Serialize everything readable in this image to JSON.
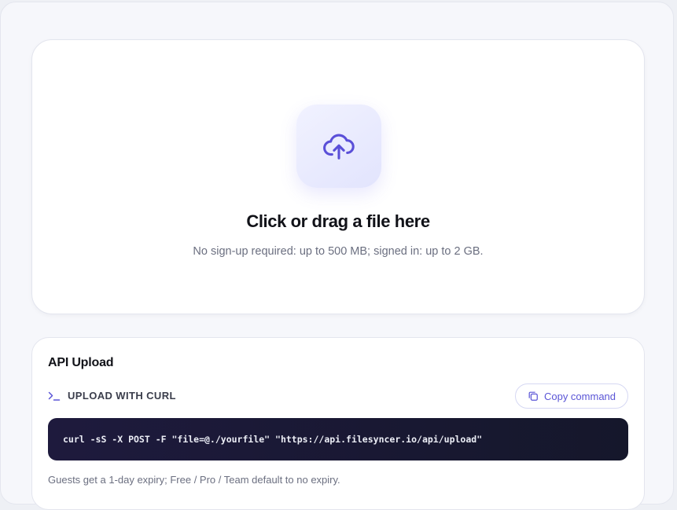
{
  "dropzone": {
    "icon": "cloud-upload-icon",
    "title": "Click or drag a file here",
    "subtitle": "No sign-up required: up to 500 MB; signed in: up to 2 GB."
  },
  "api": {
    "title": "API Upload",
    "section_icon": "terminal-icon",
    "section_label": "UPLOAD WITH CURL",
    "copy_icon": "copy-icon",
    "copy_label": "Copy command",
    "command": "curl -sS -X POST -F \"file=@./yourfile\" \"https://api.filesyncer.io/api/upload\"",
    "note": "Guests get a 1-day expiry; Free / Pro / Team default to no expiry."
  },
  "colors": {
    "accent": "#5a55d6",
    "code_bg": "#1b1935",
    "page_bg": "#f6f7fb",
    "card_bg": "#ffffff"
  }
}
